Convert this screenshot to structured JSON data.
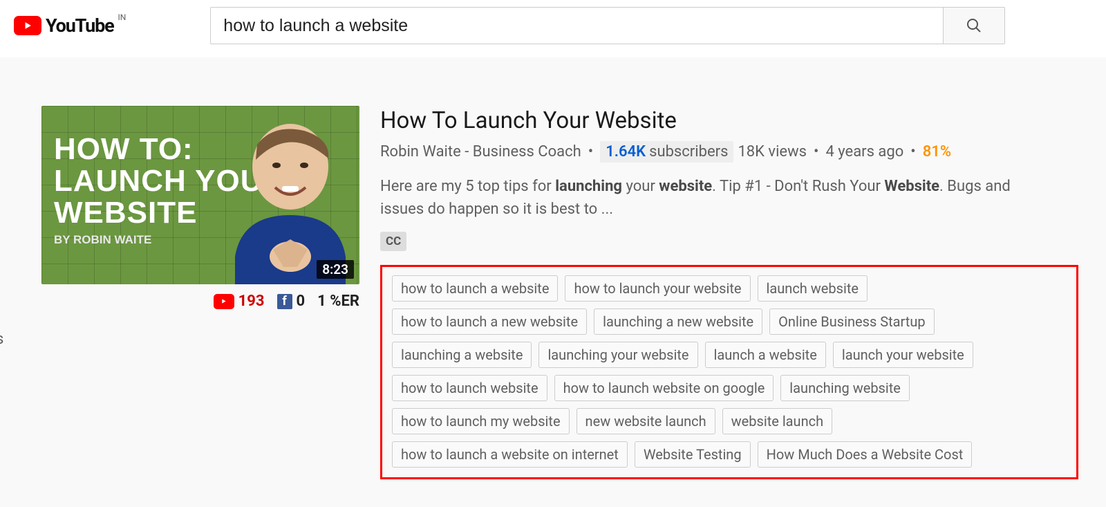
{
  "header": {
    "brand": "YouTube",
    "region": "IN",
    "search_value": "how to launch a website"
  },
  "result": {
    "thumbnail": {
      "line1": "HOW TO:",
      "line2": "LAUNCH YOUR",
      "line3": "WEBSITE",
      "byline": "BY ROBIN WAITE",
      "duration": "8:23"
    },
    "stats": {
      "yt_shares": "193",
      "fb_shares": "0",
      "engagement": "1 %ER"
    },
    "title": "How To Launch Your Website",
    "channel": "Robin Waite - Business Coach",
    "subscriber_count": "1.64K",
    "subscriber_label": "subscribers",
    "views": "18K views",
    "age": "4 years ago",
    "rating": "81%",
    "description_parts": {
      "p1": "Here are my 5 top tips for ",
      "b1": "launching",
      "p2": " your ",
      "b2": "website",
      "p3": ". Tip #1 - Don't Rush Your ",
      "b3": "Website",
      "p4": ". Bugs and issues do happen so it is best to ..."
    },
    "cc": "CC",
    "tags": [
      "how to launch a website",
      "how to launch your website",
      "launch website",
      "how to launch a new website",
      "launching a new website",
      "Online Business Startup",
      "launching a website",
      "launching your website",
      "launch a website",
      "launch your website",
      "how to launch website",
      "how to launch website on google",
      "launching website",
      "how to launch my website",
      "new website launch",
      "website launch",
      "how to launch a website on internet",
      "Website Testing",
      "How Much Does a Website Cost"
    ]
  },
  "misc": {
    "truncated_left": "s"
  }
}
